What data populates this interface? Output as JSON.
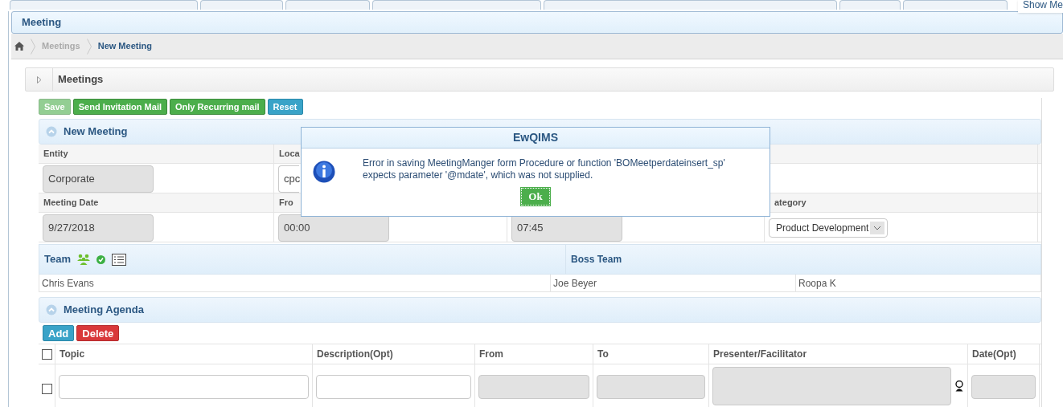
{
  "show_menu": {
    "label": "Show Me"
  },
  "page_title": "Meeting",
  "breadcrumb": [
    {
      "label": "Meetings",
      "current": false
    },
    {
      "label": "New Meeting",
      "current": true
    }
  ],
  "panel": {
    "title": "Meetings"
  },
  "toolbar": [
    {
      "label": "Save",
      "kind": "success",
      "disabled": true
    },
    {
      "label": "Send Invitation Mail",
      "kind": "success",
      "disabled": false
    },
    {
      "label": "Only Recurring mail",
      "kind": "success",
      "disabled": false
    },
    {
      "label": "Reset",
      "kind": "info",
      "disabled": false
    }
  ],
  "new_meeting": {
    "title": "New Meeting",
    "rows": [
      [
        {
          "label": "Entity",
          "value": "Corporate",
          "kind": "text",
          "disabled": true
        },
        {
          "label": "Loca",
          "value": "cpc",
          "kind": "text",
          "disabled": false
        },
        {
          "kind": "empty"
        },
        {
          "kind": "empty"
        }
      ],
      [
        {
          "label": "Meeting Date",
          "value": "9/27/2018",
          "kind": "text",
          "disabled": true
        },
        {
          "label": "Fro",
          "value": "00:00",
          "kind": "text",
          "disabled": true
        },
        {
          "value": "07:45",
          "kind": "text",
          "disabled": true
        },
        {
          "label": "ategory",
          "value": "Product Development",
          "kind": "select",
          "disabled": false
        }
      ]
    ]
  },
  "team": {
    "title": "Team",
    "members": [
      "Chris Evans"
    ]
  },
  "boss_team": {
    "title": "Boss Team",
    "members": [
      "Joe Beyer",
      "Roopa K"
    ]
  },
  "agenda": {
    "title": "Meeting Agenda",
    "buttons": [
      {
        "label": "Add",
        "kind": "info"
      },
      {
        "label": "Delete",
        "kind": "danger"
      }
    ],
    "all_checked": false,
    "columns": [
      "Topic",
      "Description(Opt)",
      "From",
      "To",
      "Presenter/Facilitator",
      "Date(Opt)"
    ],
    "rows": [
      {
        "checked": false,
        "cells": [
          {
            "disabled": false
          },
          {
            "disabled": false
          },
          {
            "disabled": true
          },
          {
            "disabled": true
          },
          {
            "disabled": true
          },
          {
            "disabled": true
          }
        ]
      }
    ]
  },
  "dialog": {
    "title": "EwQIMS",
    "message": "Error in saving MeetingManger form Procedure or function 'BOMeetperdateinsert_sp' expects parameter '@mdate', which was not supplied.",
    "button": "Ok"
  }
}
